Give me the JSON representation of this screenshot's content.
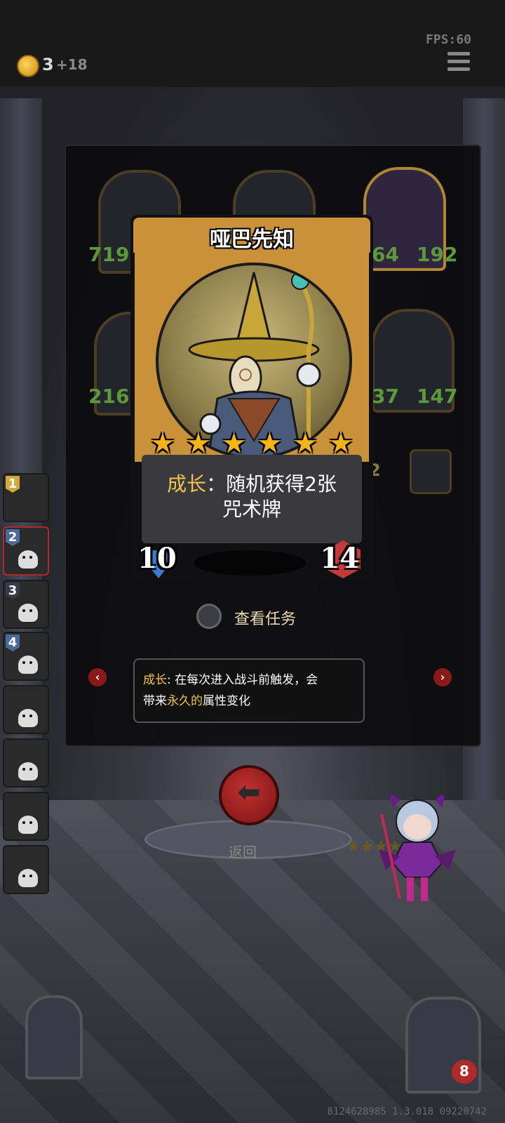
{
  "topbar": {
    "coins": "3",
    "coins_gain": "+18",
    "fps": "FPS:60"
  },
  "card": {
    "name": "哑巴先知",
    "stars": 6,
    "growth_keyword": "成长",
    "desc_line1_rest": "：随机获得2张",
    "desc_line2": "咒术牌",
    "attack": "10",
    "health": "14"
  },
  "task_button": {
    "label": "查看任务"
  },
  "tooltip": {
    "keyword": "成长",
    "line1_rest": ": 在每次进入战斗前触发，会",
    "line2_prefix": "带来",
    "line2_highlight": "永久的",
    "line2_rest": "属性变化"
  },
  "background_cards": {
    "stats": [
      "719",
      "64",
      "192",
      "216",
      "37",
      "147"
    ],
    "cost": "2"
  },
  "sidebar": {
    "slots": [
      "1",
      "2",
      "3",
      "4",
      "",
      "",
      "",
      ""
    ]
  },
  "back_button": {
    "label": "返回"
  },
  "player": {
    "lives": "8"
  },
  "footer": {
    "version": "8124628985 1.3.018 09220742"
  },
  "colors": {
    "gold_keyword": "#f2c44a",
    "card_frame": "#c8913a",
    "star": "#f5b51a",
    "back_red": "#c23030"
  }
}
